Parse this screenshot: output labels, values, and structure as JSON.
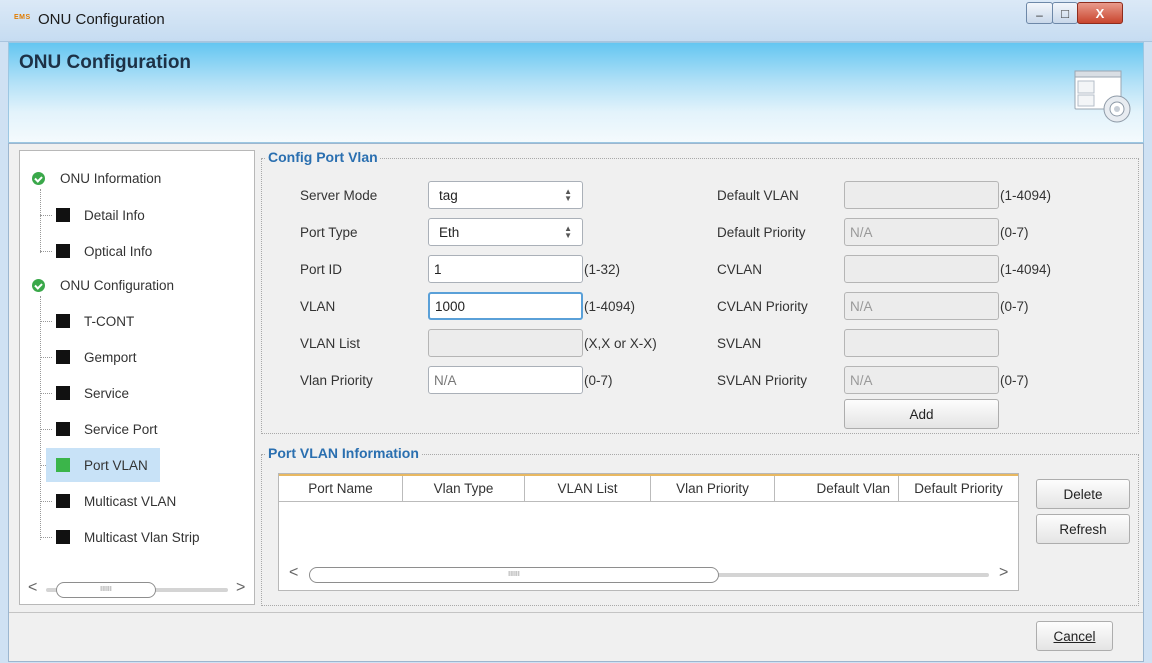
{
  "window": {
    "logo_text": "EMS",
    "title": "ONU Configuration",
    "minimize_glyph": "–",
    "maximize_glyph": "□",
    "close_glyph": "X"
  },
  "banner": {
    "title": "ONU Configuration",
    "icon": "config-gear-window-icon"
  },
  "tree": {
    "groups": [
      {
        "label": "ONU Information",
        "items": [
          "Detail Info",
          "Optical Info"
        ]
      },
      {
        "label": "ONU Configuration",
        "items": [
          "T-CONT",
          "Gemport",
          "Service",
          "Service Port",
          "Port VLAN",
          "Multicast VLAN",
          "Multicast Vlan Strip"
        ]
      }
    ],
    "selected_item": "Port VLAN",
    "scroll_left": "<",
    "scroll_right": ">",
    "scroll_grip": "IIIIII"
  },
  "config": {
    "title": "Config Port Vlan",
    "server_mode": {
      "label": "Server Mode",
      "value": "tag"
    },
    "port_type": {
      "label": "Port Type",
      "value": "Eth"
    },
    "port_id": {
      "label": "Port ID",
      "value": "1",
      "hint": "(1-32)"
    },
    "vlan": {
      "label": "VLAN",
      "value": "1000",
      "hint": "(1-4094)"
    },
    "vlan_list": {
      "label": "VLAN List",
      "value": "",
      "hint": "(X,X or X-X)"
    },
    "vlan_priority": {
      "label": "Vlan Priority",
      "value": "N/A",
      "hint": "(0-7)"
    },
    "default_vlan": {
      "label": "Default VLAN",
      "value": "",
      "hint": "(1-4094)"
    },
    "default_priority": {
      "label": "Default Priority",
      "value": "N/A",
      "hint": "(0-7)"
    },
    "cvlan": {
      "label": "CVLAN",
      "value": "",
      "hint": "(1-4094)"
    },
    "cvlan_priority": {
      "label": "CVLAN Priority",
      "value": "N/A",
      "hint": "(0-7)"
    },
    "svlan": {
      "label": "SVLAN",
      "value": ""
    },
    "svlan_priority": {
      "label": "SVLAN Priority",
      "value": "N/A",
      "hint": "(0-7)"
    },
    "add_label": "Add"
  },
  "info": {
    "title": "Port VLAN Information",
    "columns": [
      "Port Name",
      "Vlan Type",
      "VLAN List",
      "Vlan Priority",
      "Default Vlan",
      "Default Priority"
    ],
    "rows": [],
    "delete_label": "Delete",
    "refresh_label": "Refresh",
    "scroll_left": "<",
    "scroll_right": ">",
    "scroll_grip": "IIIIII"
  },
  "footer": {
    "cancel_label": "Cancel"
  },
  "colors": {
    "group_title": "#2a6fb0",
    "selected_bg": "#c8e2f7",
    "leaf_active": "#3bb54a",
    "table_header_accent": "#e8b861"
  }
}
